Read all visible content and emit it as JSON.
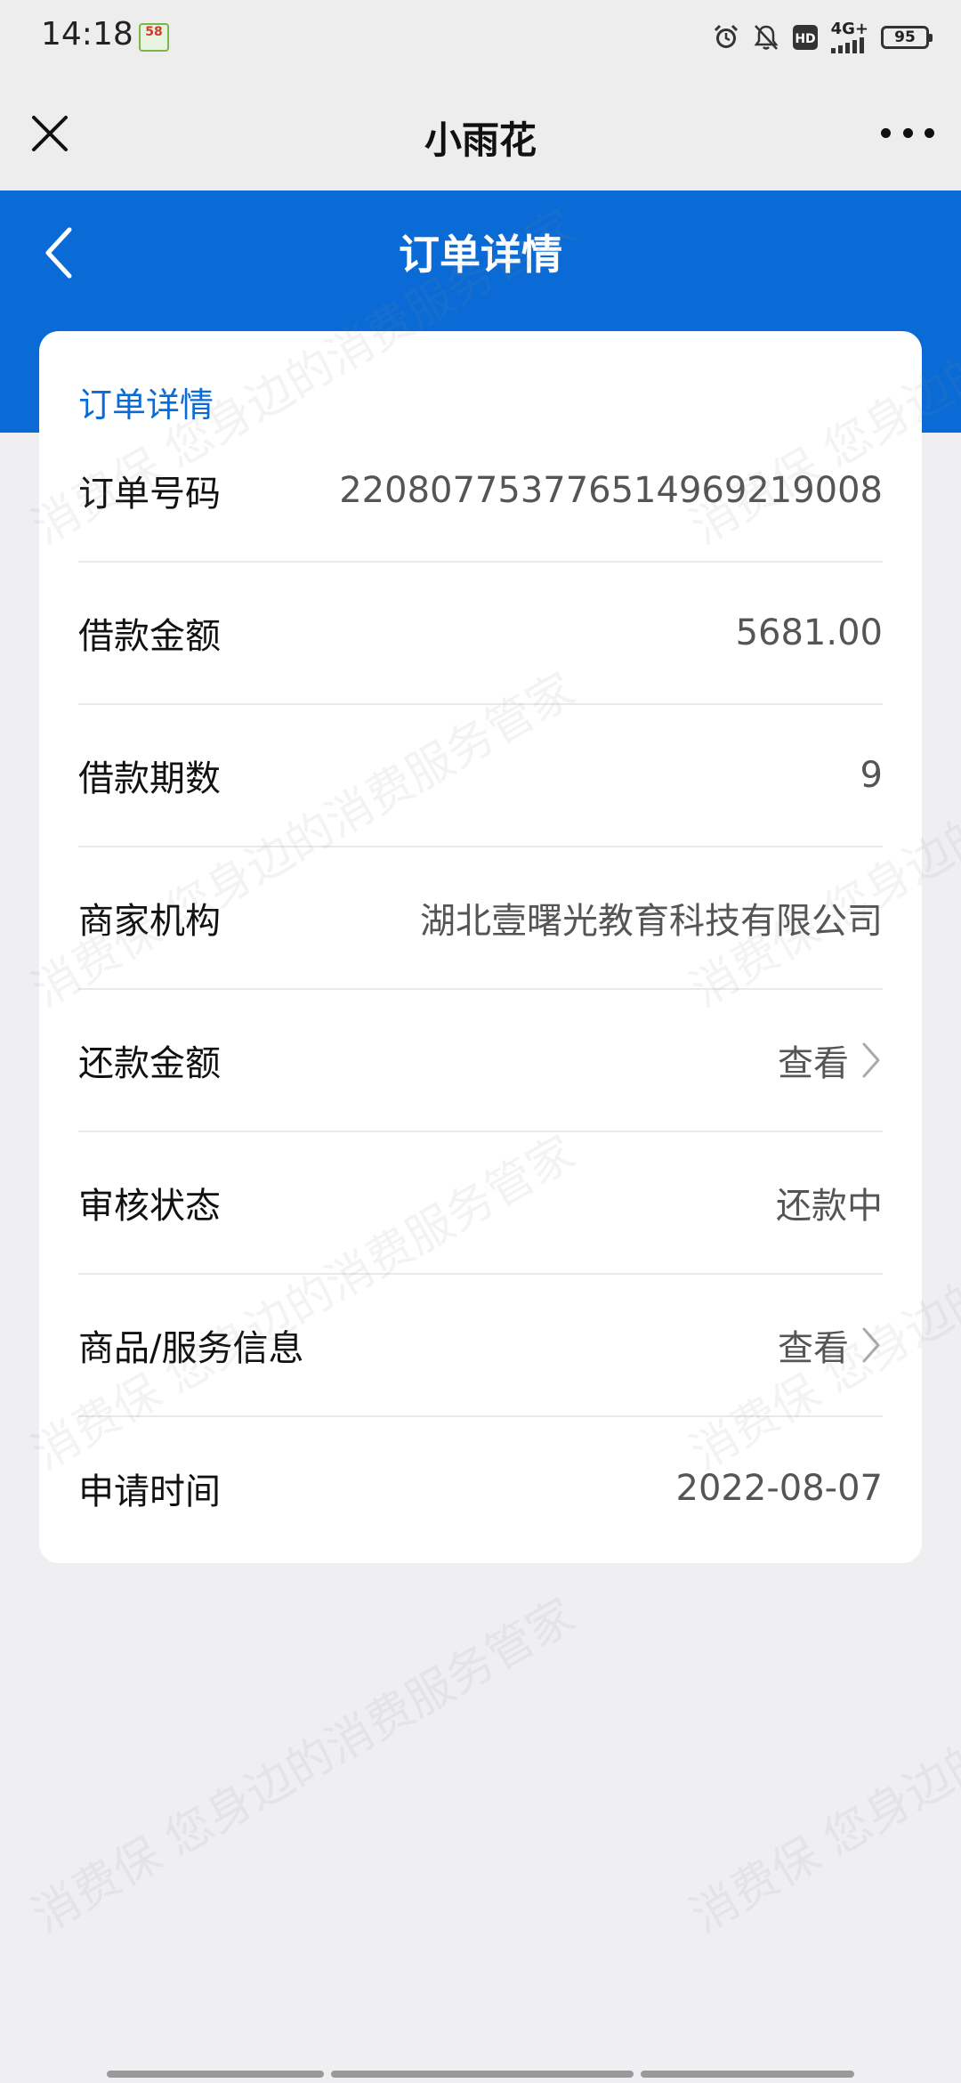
{
  "status_bar": {
    "time": "14:18",
    "app_badge": "58",
    "network": "4G+",
    "battery": "95"
  },
  "title_bar": {
    "title": "小雨花"
  },
  "header": {
    "title": "订单详情"
  },
  "card": {
    "title": "订单详情",
    "rows": [
      {
        "label": "订单号码",
        "value": "220807753776514969219008",
        "link": false
      },
      {
        "label": "借款金额",
        "value": "5681.00",
        "link": false
      },
      {
        "label": "借款期数",
        "value": "9",
        "link": false
      },
      {
        "label": "商家机构",
        "value": "湖北壹曙光教育科技有限公司",
        "link": false
      },
      {
        "label": "还款金额",
        "value": "查看",
        "link": true
      },
      {
        "label": "审核状态",
        "value": "还款中",
        "link": false
      },
      {
        "label": "商品/服务信息",
        "value": "查看",
        "link": true
      },
      {
        "label": "申请时间",
        "value": "2022-08-07",
        "link": false
      }
    ]
  },
  "watermark": {
    "text": "消费保 您身边的消费服务管家"
  }
}
